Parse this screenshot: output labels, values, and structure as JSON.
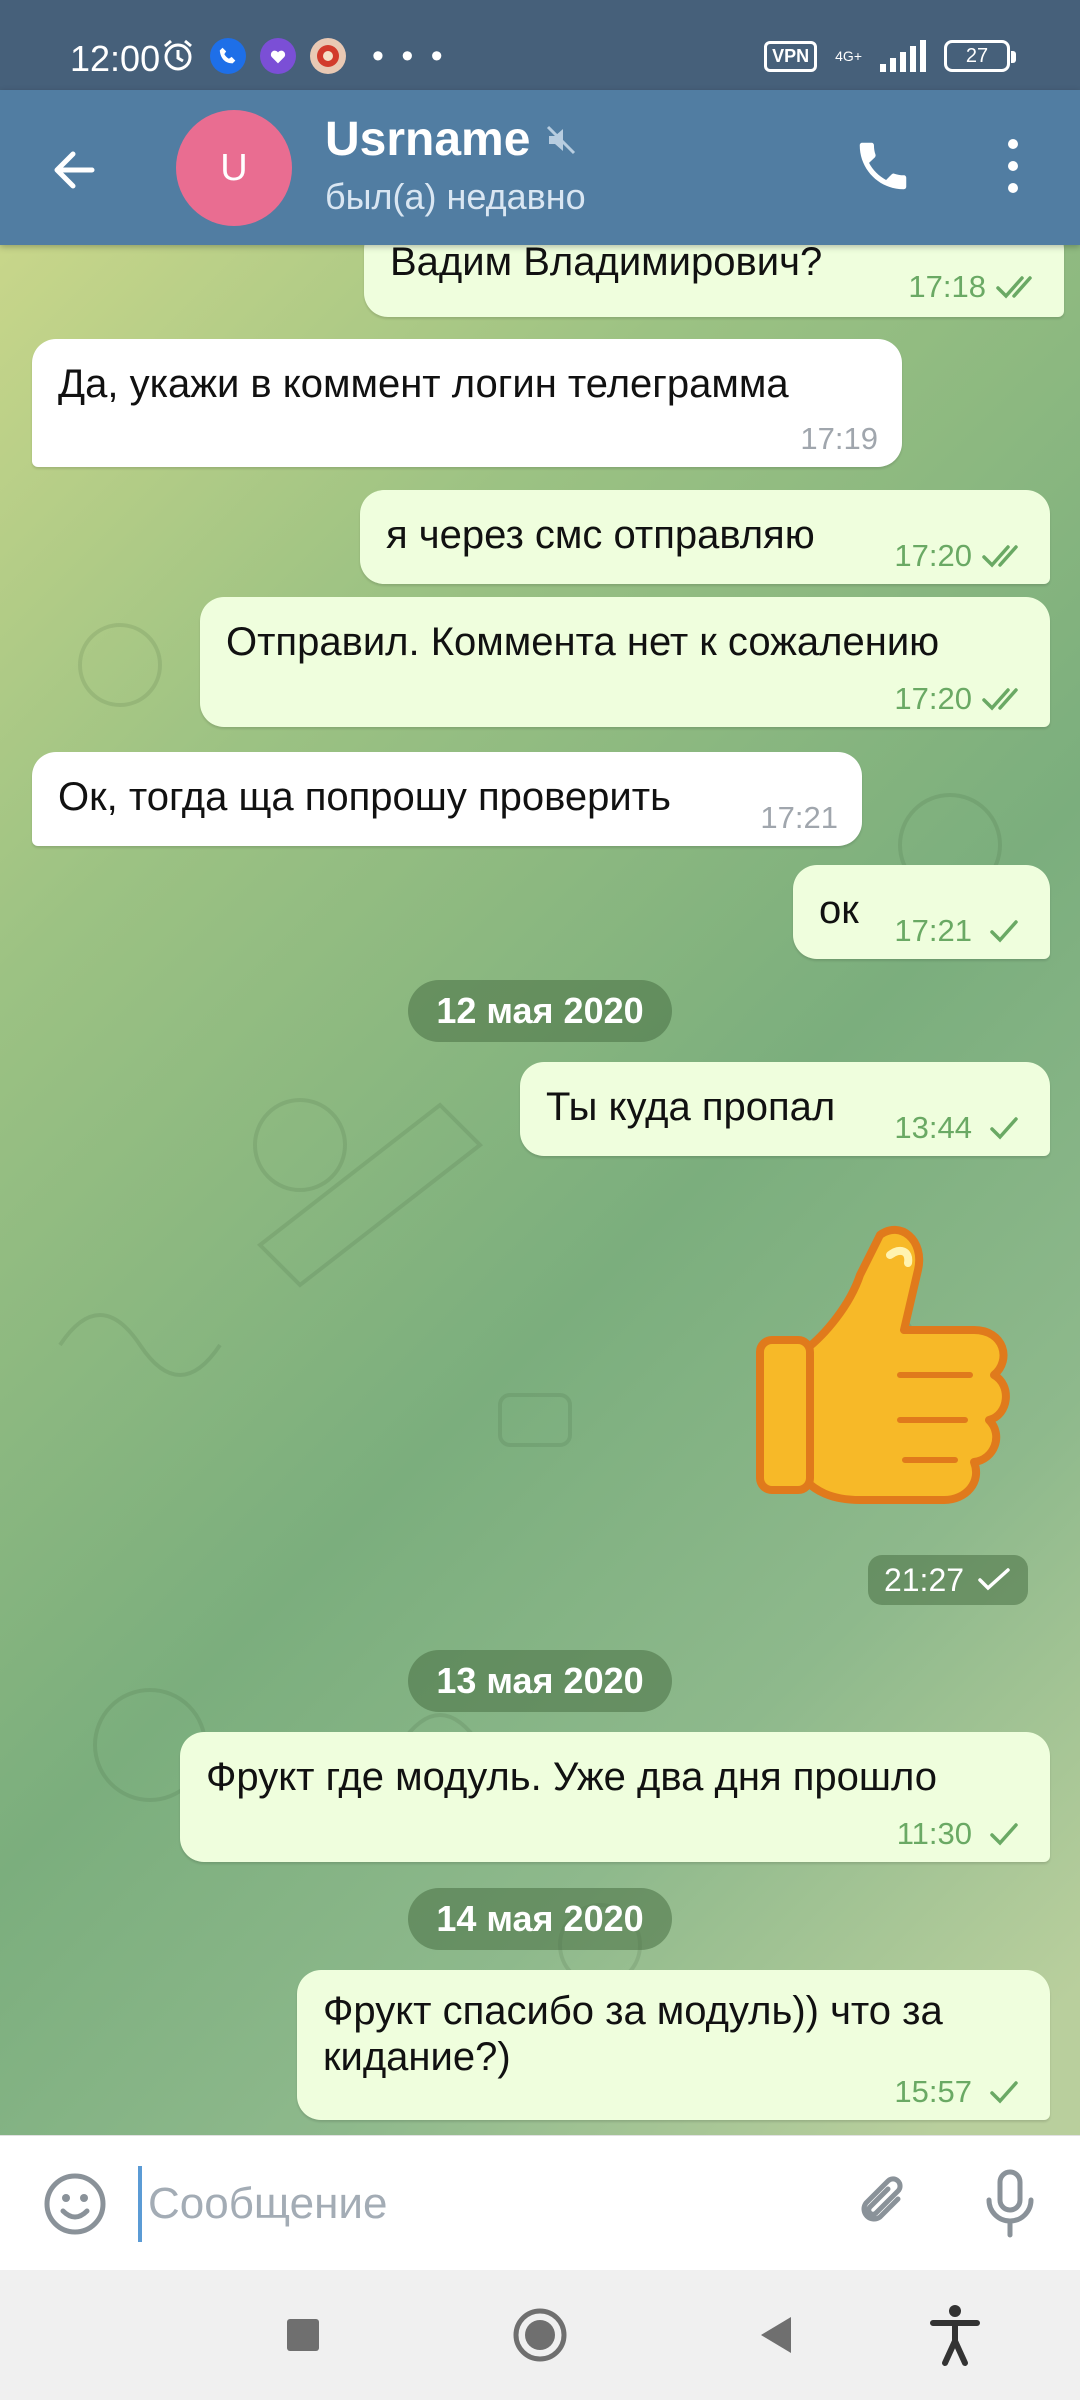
{
  "status_bar": {
    "time": "12:00",
    "icons": [
      "alarm-icon",
      "phone-app-icon",
      "viber-icon",
      "app-icon"
    ],
    "more": "• • •",
    "vpn": "VPN",
    "network": "4G+",
    "battery": "27"
  },
  "header": {
    "avatar_letter": "U",
    "name": "Usrname",
    "status": "был(а) недавно",
    "avatar_color": "#e96d91",
    "bar_color": "#517da2"
  },
  "messages": [
    {
      "text": "Вадим Владимирович?",
      "time": "17:18",
      "dir": "out",
      "read": true
    },
    {
      "text": "Да, укажи в коммент логин телеграмма",
      "time": "17:19",
      "dir": "in"
    },
    {
      "text": "я через смс отправляю",
      "time": "17:20",
      "dir": "out",
      "read": true
    },
    {
      "text": "Отправил. Коммента нет к сожалению",
      "time": "17:20",
      "dir": "out",
      "read": true
    },
    {
      "text": "Ок, тогда ща попрошу проверить",
      "time": "17:21",
      "dir": "in"
    },
    {
      "text": "ок",
      "time": "17:21",
      "dir": "out",
      "read": false
    },
    {
      "text": "Ты куда пропал",
      "time": "13:44",
      "dir": "out",
      "read": false
    },
    {
      "text": "Фрукт где модуль. Уже два дня прошло",
      "time": "11:30",
      "dir": "out",
      "read": false
    },
    {
      "text_line1": "Фрукт спасибо за модуль)) что за",
      "text_line2": "кидание?)",
      "time": "15:57",
      "dir": "out",
      "read": false
    }
  ],
  "dates": [
    "12 мая 2020",
    "13 мая 2020",
    "14 мая 2020"
  ],
  "sticker": {
    "name": "thumbs-up",
    "time": "21:27"
  },
  "composer": {
    "placeholder": "Сообщение"
  }
}
